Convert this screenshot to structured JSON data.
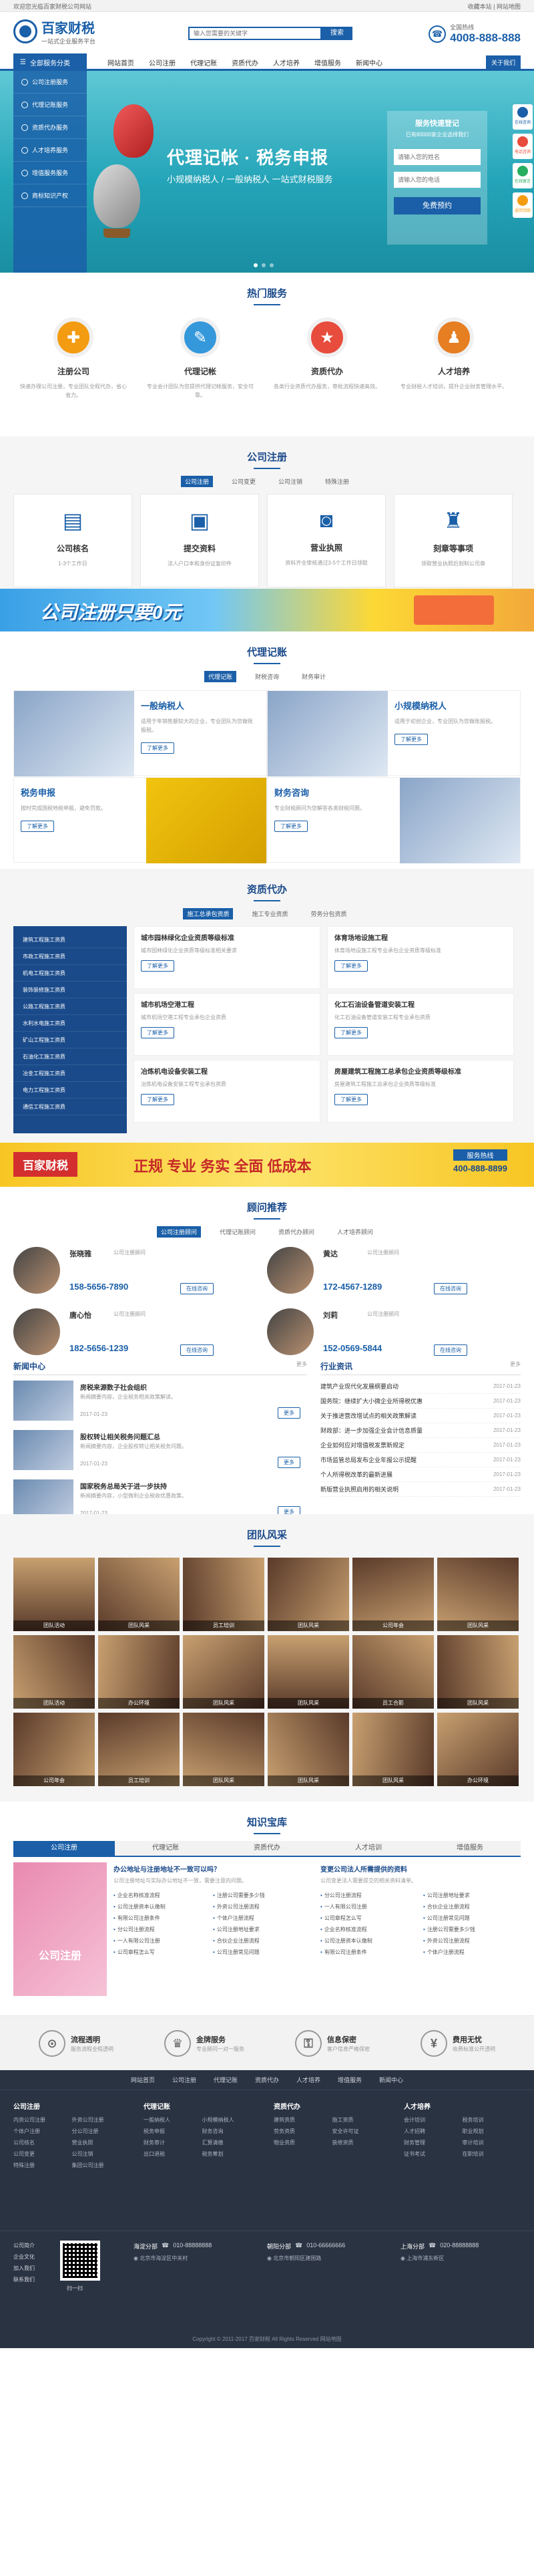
{
  "topbar": {
    "welcome": "欢迎您光临百家财税公司网站",
    "links": "收藏本站 | 网站地图"
  },
  "header": {
    "logo": "百家财税",
    "slogan": "一站式企业服务平台",
    "search_placeholder": "输入您需要的关键字",
    "search_button": "搜索",
    "hotline_label": "全国热线",
    "phone": "4008-888-888"
  },
  "nav": {
    "category": "全部服务分类",
    "items": [
      "网站首页",
      "公司注册",
      "代理记账",
      "资质代办",
      "人才培养",
      "增值服务",
      "新闻中心"
    ],
    "right": "关于我们"
  },
  "sidebar_menu": [
    "公司注册服务",
    "代理记账服务",
    "资质代办服务",
    "人才培养服务",
    "增值服务服务",
    "商标知识产权"
  ],
  "banner": {
    "title": "代理记帐 · 税务申报",
    "subtitle": "小规模纳税人 / 一般纳税人 一站式财税服务",
    "form_title": "服务快速登记",
    "form_sub": "已有80000家企业选择我们",
    "form_name": "请输入您的姓名",
    "form_phone": "请输入您的电话",
    "form_button": "免费预约"
  },
  "right_float": [
    "在线咨询",
    "电话咨询",
    "在线留言",
    "返回顶部"
  ],
  "hot_services": {
    "title": "热门服务",
    "items": [
      {
        "name": "注册公司",
        "desc": "快速办理公司注册，专业团队全程代办，省心省力。"
      },
      {
        "name": "代理记帐",
        "desc": "专业会计团队为您提供代理记帐服务，安全可靠。"
      },
      {
        "name": "资质代办",
        "desc": "各类行业资质代办服务，审批流程快速高效。"
      },
      {
        "name": "人才培养",
        "desc": "专业财税人才培训，提升企业财务管理水平。"
      }
    ]
  },
  "company_reg": {
    "title": "公司注册",
    "tabs": [
      "公司注册",
      "公司变更",
      "公司注销",
      "特殊注册"
    ],
    "items": [
      {
        "name": "公司核名",
        "desc": "1-3个工作日"
      },
      {
        "name": "提交资料",
        "desc": "法人户口本和身份证复印件"
      },
      {
        "name": "营业执照",
        "desc": "资料齐全审核通过3-5个工作日领取"
      },
      {
        "name": "刻章等事项",
        "desc": "领取营业执照后刻制公司章"
      }
    ]
  },
  "promo1": {
    "text": "公司注册只要0元"
  },
  "accounting": {
    "title": "代理记账",
    "tabs": [
      "代理记账",
      "财税咨询",
      "财务审计"
    ],
    "items": [
      {
        "name": "一般纳税人",
        "desc": "适用于年销售额较大的企业，专业团队为您做账报税。"
      },
      {
        "name": "小规模纳税人",
        "desc": "适用于初创企业，专业团队为您做账报税。"
      },
      {
        "name": "税务申报",
        "desc": "按时完成国税地税申报，避免罚款。"
      },
      {
        "name": "财务咨询",
        "desc": "专业财税顾问为您解答各类财税问题。"
      }
    ],
    "more": "了解更多"
  },
  "qualification": {
    "title": "资质代办",
    "tabs": [
      "施工总承包资质",
      "施工专业资质",
      "劳务分包资质"
    ],
    "menu": [
      "建筑工程施工资质",
      "市政工程施工资质",
      "机电工程施工资质",
      "装饰装修施工资质",
      "公路工程施工资质",
      "水利水电施工资质",
      "矿山工程施工资质",
      "石油化工施工资质",
      "冶金工程施工资质",
      "电力工程施工资质",
      "通信工程施工资质"
    ],
    "items": [
      {
        "name": "城市园林绿化企业资质等级标准",
        "desc": "城市园林绿化企业资质等级标准相关要求"
      },
      {
        "name": "体育场地设施工程",
        "desc": "体育场地设施工程专业承包企业资质等级标准"
      },
      {
        "name": "城市机场空港工程",
        "desc": "城市机场空港工程专业承包企业资质"
      },
      {
        "name": "化工石油设备管道安装工程",
        "desc": "化工石油设备管道安装工程专业承包资质"
      },
      {
        "name": "冶炼机电设备安装工程",
        "desc": "冶炼机电设备安装工程专业承包资质"
      },
      {
        "name": "房屋建筑工程施工总承包企业资质等级标准",
        "desc": "房屋建筑工程施工总承包企业资质等级标准"
      }
    ],
    "more": "了解更多"
  },
  "promo2": {
    "logo": "百家财税",
    "text": "正规 专业 务实 全面 低成本",
    "hotline": "服务热线",
    "phone": "400-888-8899"
  },
  "consultants": {
    "title": "顾问推荐",
    "tabs": [
      "公司注册顾问",
      "代理记账顾问",
      "资质代办顾问",
      "人才培养顾问"
    ],
    "people": [
      {
        "name": "张晓雅",
        "role": "公司注册顾问",
        "phone": "158-5656-7890"
      },
      {
        "name": "黄达",
        "role": "公司注册顾问",
        "phone": "172-4567-1289"
      },
      {
        "name": "唐心怡",
        "role": "公司注册顾问",
        "phone": "182-5656-1239"
      },
      {
        "name": "刘莉",
        "role": "公司注册顾问",
        "phone": "152-0569-5844"
      }
    ],
    "button": "在线咨询"
  },
  "news": {
    "title": "新闻中心",
    "more": "更多",
    "items": [
      {
        "title": "房税来源数子社会组织",
        "desc": "新闻摘要内容，企业税务相关政策解读。",
        "date": "2017-01-23"
      },
      {
        "title": "股权转让相关税务问题汇总",
        "desc": "新闻摘要内容，企业股权转让相关税务问题。",
        "date": "2017-01-23"
      },
      {
        "title": "国家税务总局关于进一步扶持",
        "desc": "新闻摘要内容，小型微利企业税收优惠政策。",
        "date": "2017-01-23"
      }
    ]
  },
  "industry": {
    "title": "行业资讯",
    "more": "更多",
    "items": [
      "建筑产业现代化发展纲要启动",
      "国务院：继续扩大小微企业所得税优惠",
      "关于推进营改增试点的相关政策解读",
      "财政部：进一步加强企业会计信息质量",
      "企业如何应对增值税发票新规定",
      "市场监管总局发布企业年报公示提醒",
      "个人所得税改革的最新进展",
      "新版营业执照启用的相关说明"
    ],
    "date": "2017-01-23"
  },
  "team": {
    "title": "团队风采",
    "captions": [
      "团队活动",
      "团队风采",
      "员工培训",
      "团队风采",
      "公司年会",
      "团队风采",
      "团队活动",
      "办公环境",
      "团队风采",
      "团队风采",
      "员工合影",
      "团队风采",
      "公司年会",
      "员工培训",
      "团队风采",
      "团队风采",
      "团队风采",
      "办公环境"
    ]
  },
  "knowledge": {
    "title": "知识宝库",
    "tabs": [
      "公司注册",
      "代理记账",
      "资质代办",
      "人才培训",
      "增值服务"
    ],
    "left_title": "办公地址与注册地址不一致可以吗？",
    "left_desc": "公司注册地址与实际办公地址不一致，需要注意的问题。",
    "right_title": "变更公司法人所需提供的资料",
    "right_desc": "公司变更法人需要提交的相关资料清单。",
    "list": [
      "企业名称核准流程",
      "注册公司需要多少钱",
      "公司注册资本认缴制",
      "外资公司注册流程",
      "有限公司注册条件",
      "个体户注册流程",
      "分公司注册流程",
      "公司注册地址要求",
      "一人有限公司注册",
      "合伙企业注册流程",
      "公司章程怎么写",
      "公司注册常见问题"
    ],
    "image_label": "公司注册"
  },
  "guarantees": [
    {
      "name": "流程透明",
      "desc": "服务流程全程透明"
    },
    {
      "name": "金牌服务",
      "desc": "专业顾问一对一服务"
    },
    {
      "name": "信息保密",
      "desc": "客户信息严格保密"
    },
    {
      "name": "费用无忧",
      "desc": "收费标准公开透明"
    }
  ],
  "footer": {
    "links": [
      "网站首页",
      "公司注册",
      "代理记账",
      "资质代办",
      "人才培养",
      "增值服务",
      "新闻中心"
    ],
    "cols": [
      {
        "title": "公司注册",
        "items": [
          "内资公司注册",
          "外资公司注册",
          "个体户注册",
          "分公司注册",
          "公司核名",
          "营业执照",
          "公司变更",
          "公司注销",
          "特殊注册",
          "集团公司注册"
        ]
      },
      {
        "title": "代理记账",
        "items": [
          "一般纳税人",
          "小规模纳税人",
          "税务申报",
          "财务咨询",
          "财务审计",
          "汇算清缴",
          "出口退税",
          "税务筹划"
        ]
      },
      {
        "title": "资质代办",
        "items": [
          "建筑资质",
          "施工资质",
          "劳务资质",
          "安全许可证",
          "物业资质",
          "装修资质"
        ]
      },
      {
        "title": "人才培养",
        "items": [
          "会计培训",
          "税务培训",
          "人才招聘",
          "职业规划",
          "财务管理",
          "审计培训",
          "证书考试",
          "在职培训"
        ]
      }
    ],
    "contacts": [
      {
        "city": "海淀分部",
        "phone": "010-88888888",
        "addr": "北京市海淀区中关村"
      },
      {
        "city": "朝阳分部",
        "phone": "010-66666666",
        "addr": "北京市朝阳区建国路"
      },
      {
        "city": "上海分部",
        "phone": "020-88888888",
        "addr": "上海市浦东新区"
      }
    ],
    "qr_label": "扫一扫",
    "left_links": [
      "公司简介",
      "企业文化",
      "加入我们",
      "联系我们"
    ],
    "copyright": "Copyright © 2011-2017 百家财税 All Rights Reserved 网站地图"
  }
}
